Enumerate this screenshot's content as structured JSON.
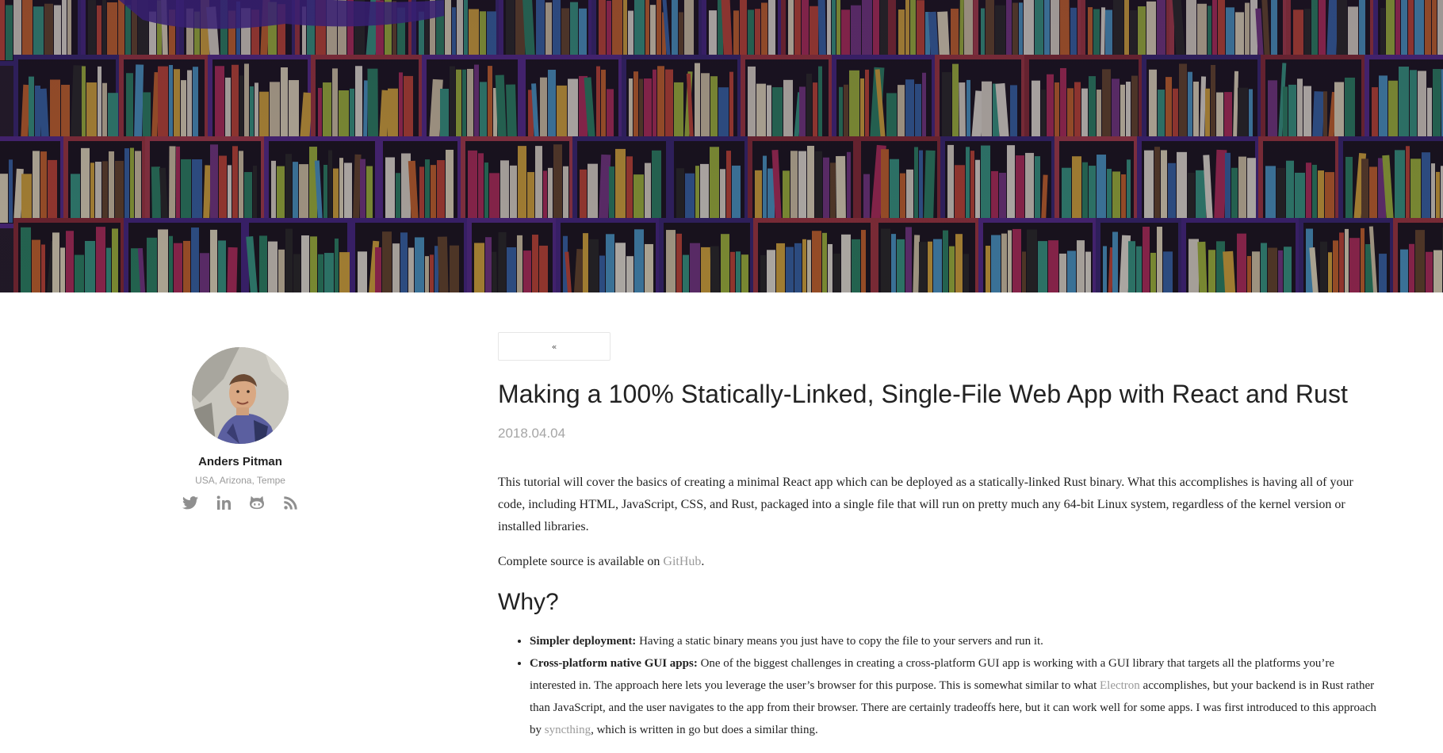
{
  "author": {
    "name": "Anders Pitman",
    "location": "USA, Arizona, Tempe",
    "social_icons": [
      "twitter-icon",
      "linkedin-icon",
      "github-icon",
      "rss-icon"
    ]
  },
  "nav": {
    "back_label": "«"
  },
  "post": {
    "title": "Making a 100% Statically-Linked, Single-File Web App with React and Rust",
    "date": "2018.04.04",
    "intro": "This tutorial will cover the basics of creating a minimal React app which can be deployed as a statically-linked Rust binary. What this accomplishes is having all of your code, including HTML, JavaScript, CSS, and Rust, packaged into a single file that will run on pretty much any 64-bit Linux system, regardless of the kernel version or installed libraries.",
    "source_prefix": "Complete source is available on ",
    "source_link": "GitHub",
    "source_suffix": ".",
    "why_heading": "Why?",
    "reasons": [
      {
        "label": "Simpler deployment:",
        "text": " Having a static binary means you just have to copy the file to your servers and run it."
      },
      {
        "label": "Cross-platform native GUI apps:",
        "text_1": " One of the biggest challenges in creating a cross-platform GUI app is working with a GUI library that targets all the platforms you’re interested in. The approach here lets you leverage the user’s browser for this purpose. This is somewhat similar to what ",
        "link_1": "Electron",
        "text_2": " accomplishes, but your backend is in Rust rather than JavaScript, and the user navigates to the app from their browser. There are certainly tradeoffs here, but it can work well for some apps. I was first introduced to this approach by ",
        "link_2": "syncthing",
        "text_3": ", which is written in go but does a similar thing."
      }
    ]
  },
  "colors": {
    "link": "#9a9a9a",
    "text": "#222222",
    "muted": "#a5a5a5"
  }
}
